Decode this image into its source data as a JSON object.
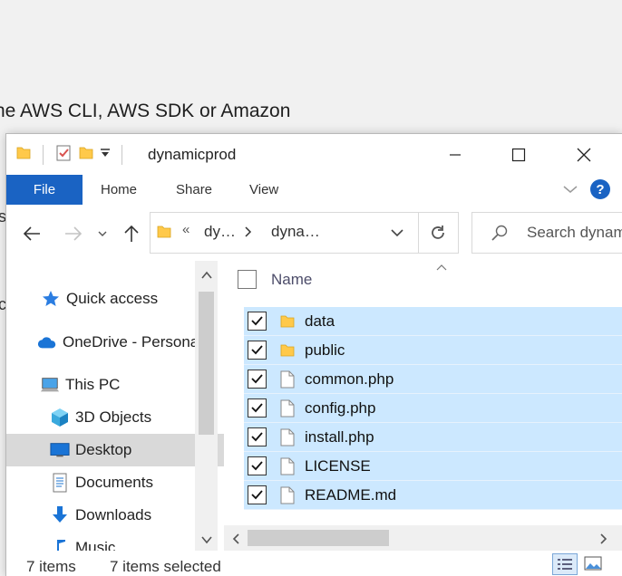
{
  "background": {
    "text": "he AWS CLI, AWS SDK or Amazon",
    "frag_top": "s",
    "frag_mid": "c"
  },
  "titlebar": {
    "title": "dynamicprod",
    "quick_access_icons": [
      "folder-icon",
      "properties-checklist-icon",
      "new-folder-icon",
      "customize-dropdown-icon"
    ]
  },
  "ribbon": {
    "tabs": [
      "File",
      "Home",
      "Share",
      "View"
    ],
    "help_label": "?"
  },
  "navigation": {
    "address_overflow": "«",
    "breadcrumbs": [
      "dy…",
      "dyna…"
    ],
    "search_placeholder": "Search dynamicprod"
  },
  "nav_pane": {
    "items": [
      {
        "label": "Quick access",
        "icon": "star-icon"
      },
      {
        "label": "OneDrive - Personal",
        "icon": "cloud-icon"
      },
      {
        "label": "This PC",
        "icon": "computer-icon"
      },
      {
        "label": "3D Objects",
        "icon": "cube-icon"
      },
      {
        "label": "Desktop",
        "icon": "desktop-icon",
        "selected": true
      },
      {
        "label": "Documents",
        "icon": "documents-icon"
      },
      {
        "label": "Downloads",
        "icon": "download-icon"
      },
      {
        "label": "Music",
        "icon": "music-icon"
      }
    ]
  },
  "file_list": {
    "column_name": "Name",
    "files": [
      {
        "name": "data",
        "type": "folder"
      },
      {
        "name": "public",
        "type": "folder"
      },
      {
        "name": "common.php",
        "type": "file"
      },
      {
        "name": "config.php",
        "type": "file"
      },
      {
        "name": "install.php",
        "type": "file"
      },
      {
        "name": "LICENSE",
        "type": "file"
      },
      {
        "name": "README.md",
        "type": "file"
      }
    ]
  },
  "status": {
    "item_count": "7 items",
    "selected_count": "7 items selected"
  },
  "colors": {
    "accent": "#1a63c3",
    "selection": "#cce8ff",
    "folder": "#ffc94a"
  }
}
